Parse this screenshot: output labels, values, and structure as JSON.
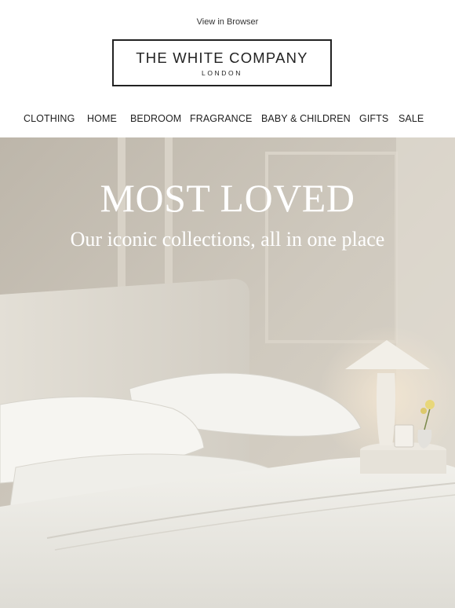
{
  "header": {
    "view_in_browser": "View in Browser",
    "logo_title": "THE WHITE COMPANY",
    "logo_subtitle": "LONDON"
  },
  "nav": {
    "items": [
      "CLOTHING",
      "HOME",
      "BEDROOM",
      "FRAGRANCE",
      "BABY & CHILDREN",
      "GIFTS",
      "SALE"
    ]
  },
  "hero": {
    "title": "MOST LOVED",
    "subtitle": "Our iconic collections, all in one place",
    "image_alt": "bedroom-with-white-bedding-icon"
  },
  "colors": {
    "text": "#222222",
    "hero_text": "#ffffff",
    "wall": "#c9c3b8",
    "bedding": "#eceae3"
  }
}
